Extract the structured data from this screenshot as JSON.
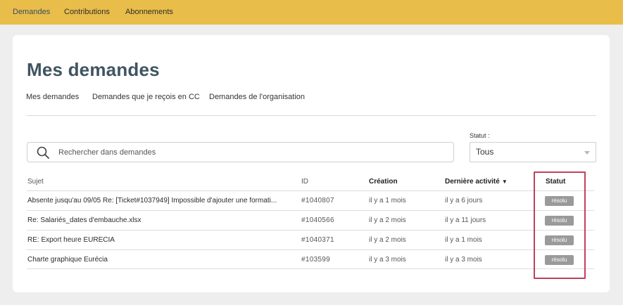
{
  "topnav": {
    "items": [
      {
        "label": "Demandes",
        "active": true
      },
      {
        "label": "Contributions",
        "active": false
      },
      {
        "label": "Abonnements",
        "active": false
      }
    ]
  },
  "page": {
    "title": "Mes demandes"
  },
  "subnav": {
    "items": [
      {
        "label": "Mes demandes"
      },
      {
        "label": "Demandes que je reçois en CC"
      },
      {
        "label": "Demandes de l'organisation"
      }
    ]
  },
  "search": {
    "placeholder": "Rechercher dans demandes",
    "value": ""
  },
  "status_filter": {
    "label": "Statut :",
    "selected": "Tous"
  },
  "table": {
    "headers": {
      "subject": "Sujet",
      "id": "ID",
      "created": "Création",
      "last_activity": "Dernière activité",
      "sort_indicator": "▼",
      "status": "Statut"
    },
    "rows": [
      {
        "subject": "Absente jusqu'au 09/05 Re: [Ticket#1037949] Impossible d'ajouter une formati...",
        "id": "#1040807",
        "created": "il y a 1 mois",
        "last_activity": "il y a 6 jours",
        "status": "résolu"
      },
      {
        "subject": "Re: Salariés_dates d'embauche.xlsx",
        "id": "#1040566",
        "created": "il y a 2 mois",
        "last_activity": "il y a 11 jours",
        "status": "résolu"
      },
      {
        "subject": "RE: Export heure EURECIA",
        "id": "#1040371",
        "created": "il y a 2 mois",
        "last_activity": "il y a 1 mois",
        "status": "résolu"
      },
      {
        "subject": "Charte graphique Eurécia",
        "id": "#103599",
        "created": "il y a 3 mois",
        "last_activity": "il y a 3 mois",
        "status": "résolu"
      }
    ]
  },
  "colors": {
    "topbar": "#e8bd4a",
    "title": "#3f5560",
    "badge": "#9a9a9a",
    "highlight": "#c0405f"
  }
}
